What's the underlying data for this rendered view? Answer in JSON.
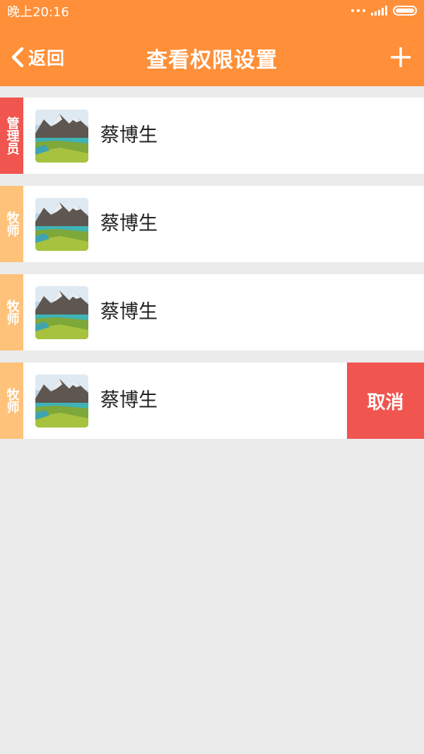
{
  "status_bar": {
    "time": "晚上20:16",
    "icons": [
      "more-dots-icon",
      "signal-icon",
      "battery-icon"
    ]
  },
  "nav": {
    "back_label": "返回",
    "back_icon": "chevron-left-icon",
    "title": "查看权限设置",
    "add_icon": "plus-icon"
  },
  "colors": {
    "header_bg": "#ff8f38",
    "admin_badge": "#f0554f",
    "pastor_badge": "#ffc27a",
    "cancel_bg": "#f0554f",
    "page_bg": "#ebebeb"
  },
  "items": [
    {
      "role": "管理员",
      "name": "蔡博生",
      "avatar": "landscape-avatar"
    },
    {
      "role": "牧师",
      "name": "蔡博生",
      "avatar": "landscape-avatar"
    },
    {
      "role": "牧师",
      "name": "蔡博生",
      "avatar": "landscape-avatar"
    },
    {
      "role": "牧师",
      "name": "蔡博生",
      "avatar": "landscape-avatar",
      "swipe_action": "取消"
    }
  ]
}
